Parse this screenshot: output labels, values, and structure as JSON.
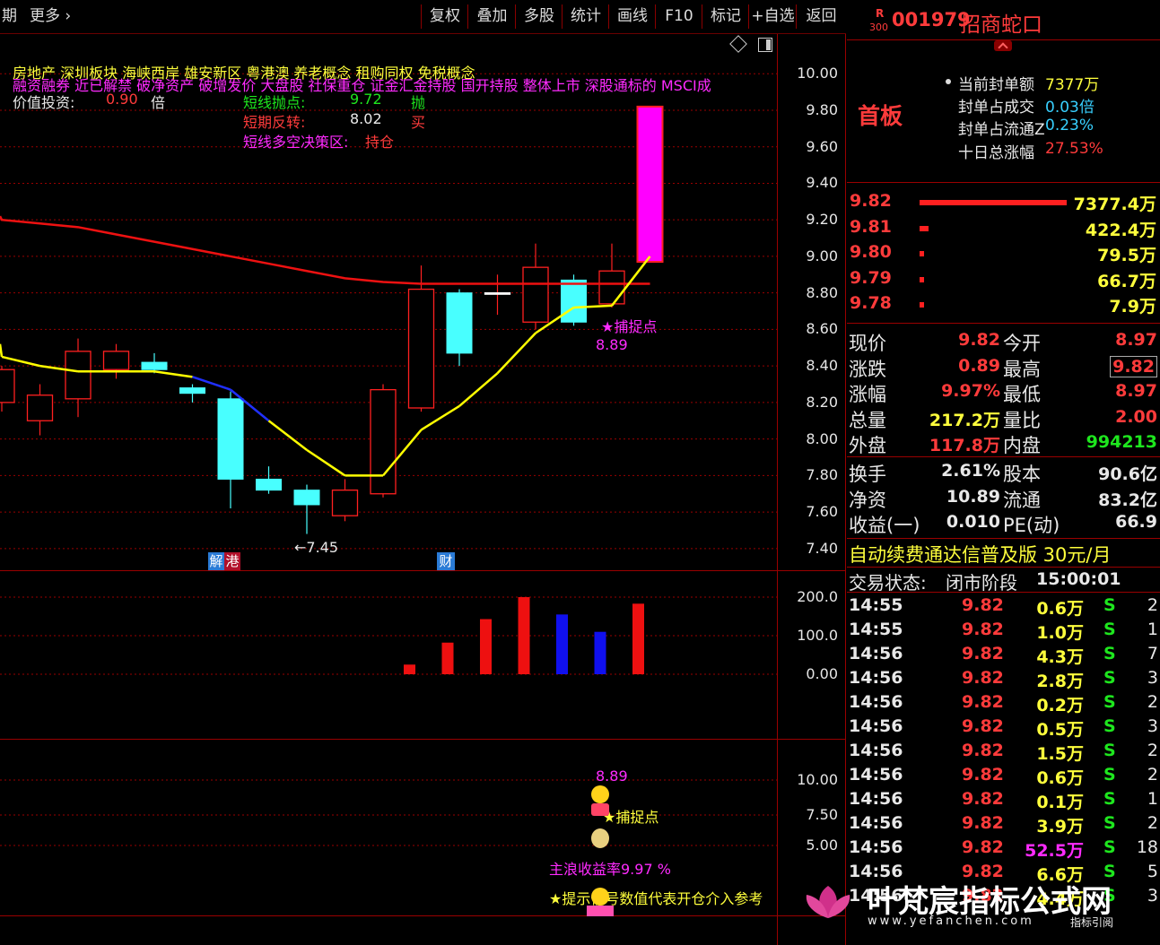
{
  "toolbar": {
    "left_text": "期",
    "more_label": "更多",
    "more_arrow": "›",
    "buttons": [
      "复权",
      "叠加",
      "多股",
      "统计",
      "画线",
      "F10",
      "标记",
      "+自选",
      "返回"
    ]
  },
  "stock": {
    "badge_top": "R",
    "badge_bottom": "300",
    "code": "001979",
    "name": "招商蛇口",
    "collapse_icon": "chevron-up-icon"
  },
  "concepts": {
    "line1": "房地产     深圳板块  海峡西岸 雄安新区 粤港澳 养老概念 租购同权 免税概念",
    "line2": "融资融券 近已解禁 破净资产 破增发价 大盘股 社保重仓 证金汇金持股 国开持股 整体上市 深股通标的 MSCI成",
    "value_label": "价值投资:",
    "value_num": "0.90",
    "value_unit": "倍"
  },
  "strategy": {
    "row1_label": "短线抛点:",
    "row1_value": "9.72",
    "row1_action": "抛",
    "row2_label": "短期反转:",
    "row2_value": "8.02",
    "row2_action": "买",
    "row3_label": "短线多空决策区:",
    "row3_action": "持仓"
  },
  "main_chart_labels": {
    "capture_label": "★捕捉点",
    "capture_value": "8.89",
    "low_label": "←7.45",
    "tag_jie": "解",
    "tag_gang": "港",
    "tag_cai": "财"
  },
  "chart_data": [
    {
      "type": "candlestick",
      "y_ticks": [
        "10.00",
        "9.80",
        "9.60",
        "9.40",
        "9.20",
        "9.00",
        "8.80",
        "8.60",
        "8.40",
        "8.20",
        "8.00",
        "7.80",
        "7.60",
        "7.40"
      ],
      "ylim": [
        7.36,
        10.06
      ],
      "candles": [
        {
          "open": 8.2,
          "close": 8.38,
          "high": 8.4,
          "low": 8.15
        },
        {
          "open": 8.1,
          "close": 8.24,
          "high": 8.3,
          "low": 8.02
        },
        {
          "open": 8.22,
          "close": 8.48,
          "high": 8.55,
          "low": 8.12
        },
        {
          "open": 8.38,
          "close": 8.48,
          "high": 8.52,
          "low": 8.33
        },
        {
          "open": 8.42,
          "close": 8.38,
          "high": 8.47,
          "low": 8.36
        },
        {
          "open": 8.28,
          "close": 8.25,
          "high": 8.3,
          "low": 8.2
        },
        {
          "open": 8.22,
          "close": 7.78,
          "high": 8.26,
          "low": 7.62
        },
        {
          "open": 7.78,
          "close": 7.72,
          "high": 7.85,
          "low": 7.7
        },
        {
          "open": 7.72,
          "close": 7.64,
          "high": 7.75,
          "low": 7.48
        },
        {
          "open": 7.58,
          "close": 7.72,
          "high": 7.78,
          "low": 7.55
        },
        {
          "open": 7.7,
          "close": 8.27,
          "high": 8.3,
          "low": 7.68
        },
        {
          "open": 8.17,
          "close": 8.82,
          "high": 8.95,
          "low": 8.15
        },
        {
          "open": 8.8,
          "close": 8.47,
          "high": 8.82,
          "low": 8.4
        },
        {
          "open": 8.8,
          "close": 8.8,
          "high": 8.9,
          "low": 8.68
        },
        {
          "open": 8.64,
          "close": 8.94,
          "high": 9.07,
          "low": 8.6
        },
        {
          "open": 8.87,
          "close": 8.64,
          "high": 8.9,
          "low": 8.62
        },
        {
          "open": 8.74,
          "close": 8.92,
          "high": 9.07,
          "low": 8.72
        },
        {
          "open": 8.97,
          "close": 9.82,
          "high": 9.82,
          "low": 8.97
        }
      ],
      "ma_long": [
        9.2,
        9.18,
        9.16,
        9.12,
        9.08,
        9.04,
        9.0,
        8.96,
        8.92,
        8.88,
        8.86,
        8.85,
        8.85,
        8.85,
        8.85,
        8.85,
        8.85,
        8.85
      ],
      "ma_short": [
        8.45,
        8.4,
        8.37,
        8.37,
        8.37,
        8.34,
        8.27,
        8.1,
        7.94,
        7.8,
        7.8,
        8.05,
        8.18,
        8.36,
        8.58,
        8.72,
        8.73,
        9.0
      ]
    },
    {
      "type": "bar",
      "y_ticks": [
        "200.0",
        "100.0",
        "0.00"
      ],
      "ylim": [
        0,
        200
      ],
      "values": [
        25,
        82,
        143,
        200,
        155,
        110,
        183
      ],
      "colors": [
        "red",
        "red",
        "red",
        "red",
        "blue",
        "blue",
        "red"
      ]
    },
    {
      "type": "indicator",
      "y_ticks": [
        "10.00",
        "7.50",
        "5.00"
      ],
      "labels": [
        "8.89",
        "★捕捉点",
        "主浪收益率9.97  %",
        "★提示信号数值代表开仓介入参考"
      ]
    }
  ],
  "seal": {
    "title": "首板",
    "rows": [
      {
        "label": "当前封单额",
        "value": "7377万"
      },
      {
        "label": "封单占成交",
        "value": "0.03倍"
      },
      {
        "label": "封单占流通Z",
        "value": "0.23%"
      },
      {
        "label": "十日总涨幅",
        "value": "27.53%"
      }
    ]
  },
  "order_book": [
    {
      "price": "9.82",
      "volume": "7377.4万",
      "bar": 1.0
    },
    {
      "price": "9.81",
      "volume": "422.4万",
      "bar": 0.06
    },
    {
      "price": "9.80",
      "volume": "79.5万",
      "bar": 0.02
    },
    {
      "price": "9.79",
      "volume": "66.7万",
      "bar": 0.02
    },
    {
      "price": "9.78",
      "volume": "7.9万",
      "bar": 0.02
    }
  ],
  "quote": [
    {
      "l1": "现价",
      "v1": "9.82",
      "c1": "red",
      "l2": "今开",
      "v2": "8.97",
      "c2": "red"
    },
    {
      "l1": "涨跌",
      "v1": "0.89",
      "c1": "red",
      "l2": "最高",
      "v2": "9.82",
      "c2": "red"
    },
    {
      "l1": "涨幅",
      "v1": "9.97%",
      "c1": "red",
      "l2": "最低",
      "v2": "8.97",
      "c2": "red"
    },
    {
      "l1": "总量",
      "v1": "217.2万",
      "c1": "yel",
      "l2": "量比",
      "v2": "2.00",
      "c2": "red"
    },
    {
      "l1": "外盘",
      "v1": "117.8万",
      "c1": "red",
      "l2": "内盘",
      "v2": "994213",
      "c2": "grn"
    }
  ],
  "fundamentals": [
    {
      "l1": "换手",
      "v1": "2.61%",
      "l2": "股本",
      "v2": "90.6亿"
    },
    {
      "l1": "净资",
      "v1": "10.89",
      "l2": "流通",
      "v2": "83.2亿"
    },
    {
      "l1": "收益(一)",
      "v1": "0.010",
      "l2": "PE(动)",
      "v2": "66.9"
    }
  ],
  "promo": "自动续费通达信普及版  30元/月",
  "trade_status": {
    "label": "交易状态:",
    "state": "闭市阶段",
    "time": "15:00:01"
  },
  "ticks": [
    {
      "time": "14:55",
      "price": "9.82",
      "vol": "0.6万",
      "side": "S",
      "n": "2"
    },
    {
      "time": "14:55",
      "price": "9.82",
      "vol": "1.0万",
      "side": "S",
      "n": "1"
    },
    {
      "time": "14:56",
      "price": "9.82",
      "vol": "4.3万",
      "side": "S",
      "n": "7"
    },
    {
      "time": "14:56",
      "price": "9.82",
      "vol": "2.8万",
      "side": "S",
      "n": "3"
    },
    {
      "time": "14:56",
      "price": "9.82",
      "vol": "0.2万",
      "side": "S",
      "n": "2"
    },
    {
      "time": "14:56",
      "price": "9.82",
      "vol": "0.5万",
      "side": "S",
      "n": "3"
    },
    {
      "time": "14:56",
      "price": "9.82",
      "vol": "1.5万",
      "side": "S",
      "n": "2"
    },
    {
      "time": "14:56",
      "price": "9.82",
      "vol": "0.6万",
      "side": "S",
      "n": "2"
    },
    {
      "time": "14:56",
      "price": "9.82",
      "vol": "0.1万",
      "side": "S",
      "n": "1"
    },
    {
      "time": "14:56",
      "price": "9.82",
      "vol": "3.9万",
      "side": "S",
      "n": "2"
    },
    {
      "time": "14:56",
      "price": "9.82",
      "vol": "52.5万",
      "side": "S",
      "n": "18"
    },
    {
      "time": "14:56",
      "price": "9.82",
      "vol": "6.6万",
      "side": "S",
      "n": "5"
    },
    {
      "time": "14:56",
      "price": "9.82",
      "vol": "4.4万",
      "side": "S",
      "n": "3"
    }
  ],
  "watermark": {
    "title": "叶梵宸指标公式网",
    "url": "www.yefanchen.com",
    "sub": "指标引阅"
  },
  "colors": {
    "up": "#ff2020",
    "down": "#48ffff",
    "grid": "#9a0000",
    "ma_long": "#ee1111",
    "ma_short": "#ffff00",
    "ma_short_down": "#2030ff",
    "limit_up": "#ff00ff"
  }
}
